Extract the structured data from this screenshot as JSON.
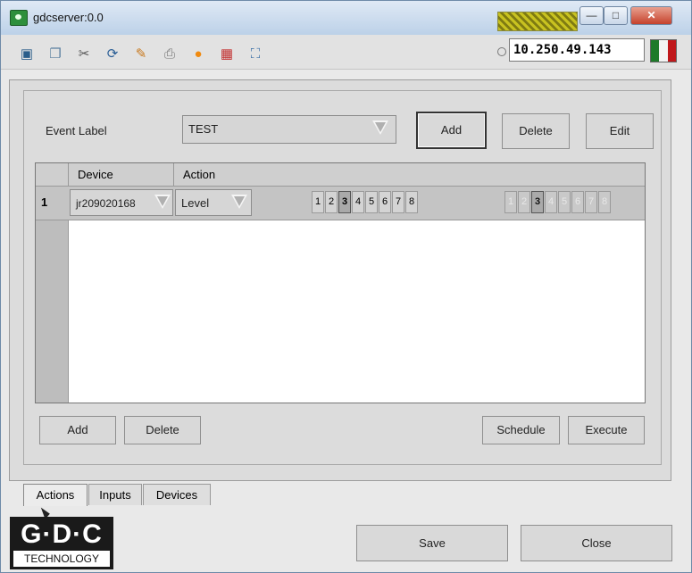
{
  "window": {
    "title": "gdcserver:0.0",
    "min_glyph": "—",
    "max_glyph": "□",
    "close_glyph": "✕"
  },
  "toolbar": {
    "icons": [
      "monitor-icon",
      "windows-icon",
      "tools-icon",
      "refresh-icon",
      "color-icon",
      "printer-icon",
      "alert-icon",
      "network-icon",
      "fullscreen-icon"
    ],
    "ip_address": "10.250.49.143"
  },
  "event": {
    "label": "Event Label",
    "value": "TEST",
    "add": "Add",
    "delete": "Delete",
    "edit": "Edit"
  },
  "table": {
    "headers": [
      "Device",
      "Action"
    ],
    "rows": [
      {
        "index": "1",
        "device": "jr209020168",
        "action": "Level",
        "levels_a": [
          "1",
          "2",
          "3",
          "4",
          "5",
          "6",
          "7",
          "8"
        ],
        "selected_a": "3",
        "levels_b": [
          "1",
          "2",
          "3",
          "4",
          "5",
          "6",
          "7",
          "8"
        ],
        "selected_b": "3"
      }
    ]
  },
  "buttons": {
    "add": "Add",
    "delete": "Delete",
    "schedule": "Schedule",
    "execute": "Execute",
    "save": "Save",
    "close": "Close"
  },
  "tabs": [
    "Actions",
    "Inputs",
    "Devices"
  ],
  "logo": {
    "main": "G·D·C",
    "sub": "TECHNOLOGY"
  },
  "colors": {
    "flag_green": "#1e7a2a",
    "flag_white": "#f4f4f4",
    "flag_red": "#c0181b"
  }
}
